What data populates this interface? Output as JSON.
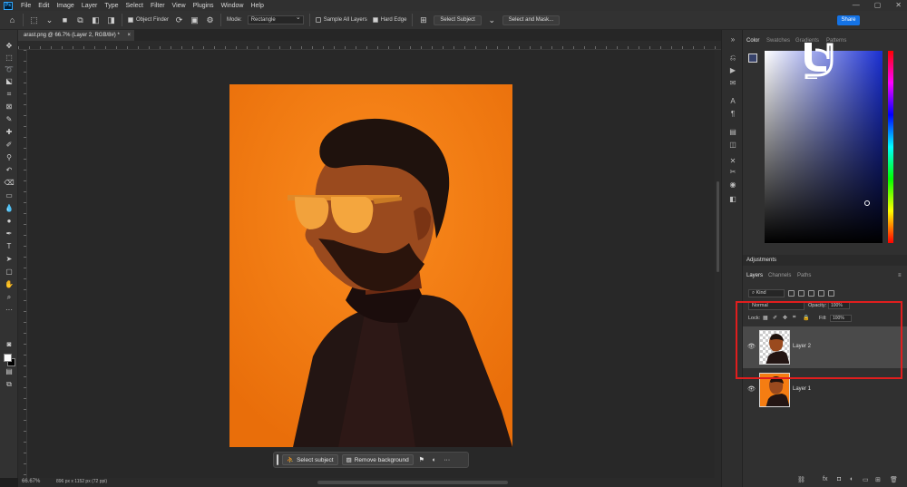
{
  "app": {
    "logo_text": "Ps"
  },
  "menu": [
    "File",
    "Edit",
    "Image",
    "Layer",
    "Type",
    "Select",
    "Filter",
    "View",
    "Plugins",
    "Window",
    "Help"
  ],
  "window_controls": {
    "minimize": "—",
    "maximize": "▢",
    "close": "✕"
  },
  "options_bar": {
    "object_finder_label": "Object Finder",
    "mode_label": "Mode:",
    "mode_value": "Rectangle",
    "sample_all_layers_label": "Sample All Layers",
    "hard_edge_label": "Hard Edge",
    "select_subject_label": "Select Subject",
    "select_and_mask_label": "Select and Mask...",
    "share_label": "Share"
  },
  "document_tab": {
    "title": "arast.png @ 66.7% (Layer 2, RGB/8#) *",
    "close": "×"
  },
  "contextual_task_bar": {
    "select_subject_label": "Select subject",
    "remove_background_label": "Remove background",
    "more": "···"
  },
  "status_bar": {
    "zoom": "66.67%",
    "dimensions": "896 px x 1152 px (72 ppi)"
  },
  "color_panel": {
    "tabs": [
      "Color",
      "Swatches",
      "Gradients",
      "Patterns"
    ],
    "foreground": "#37426a",
    "background": "#ffffff"
  },
  "adjustments_panel": {
    "title": "Adjustments"
  },
  "layers_panel": {
    "tabs": [
      "Layers",
      "Channels",
      "Paths"
    ],
    "kind_label": "Kind",
    "blend_mode": "Normal",
    "opacity_label": "Opacity:",
    "opacity_value": "100%",
    "lock_label": "Lock:",
    "fill_label": "Fill:",
    "fill_value": "100%",
    "layers": [
      {
        "name": "Layer 2",
        "selected": true,
        "transparent_bg": true
      },
      {
        "name": "Layer 1",
        "selected": false,
        "transparent_bg": false
      }
    ]
  },
  "colors": {
    "photo_background": "#f57d12",
    "highlight_box": "#e01e1e",
    "share_button": "#1473e6"
  }
}
